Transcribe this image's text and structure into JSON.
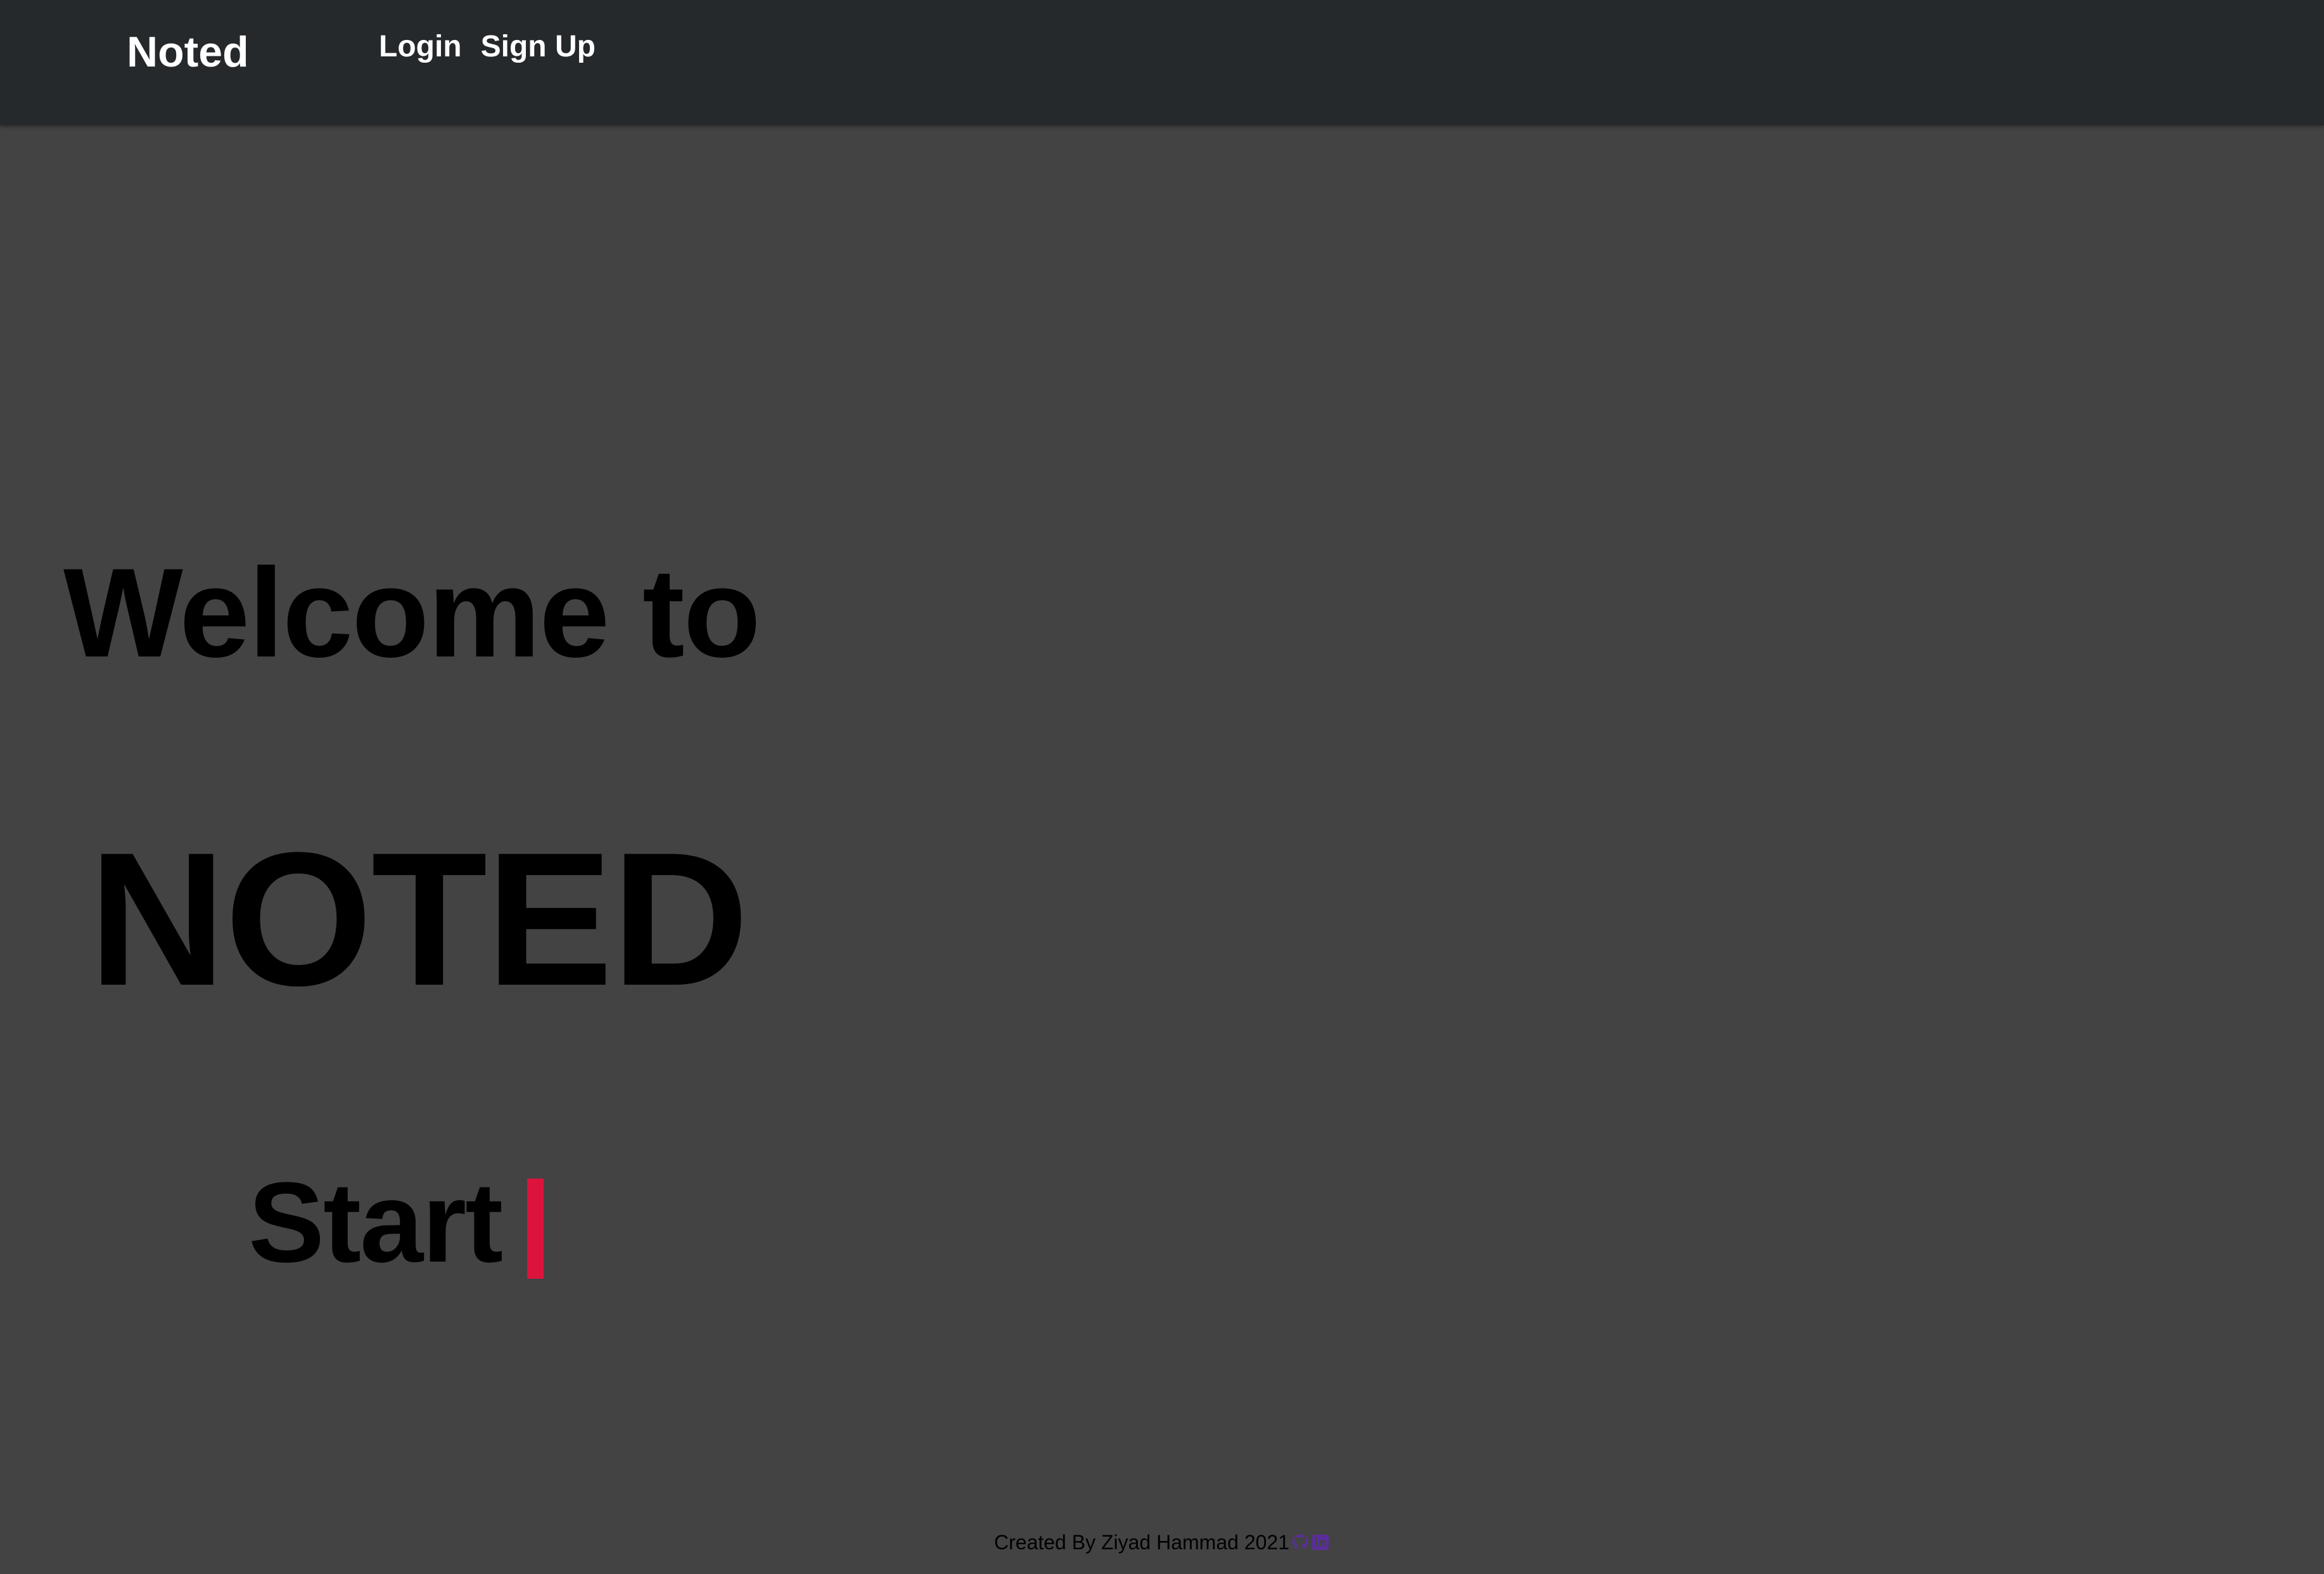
{
  "navbar": {
    "brand": "Noted",
    "links": [
      "Login",
      "Sign Up"
    ]
  },
  "hero": {
    "line1": "Welcome to",
    "line2": "NOTED",
    "line3": "Start"
  },
  "footer": {
    "text": "Created By Ziyad Hammad 2021",
    "icons": [
      "github-icon",
      "linkedin-icon"
    ]
  },
  "colors": {
    "navbar_bg": "#25292c",
    "page_bg": "#434343",
    "cursor": "#dc143c",
    "footer_icon": "#5b2d9c"
  }
}
